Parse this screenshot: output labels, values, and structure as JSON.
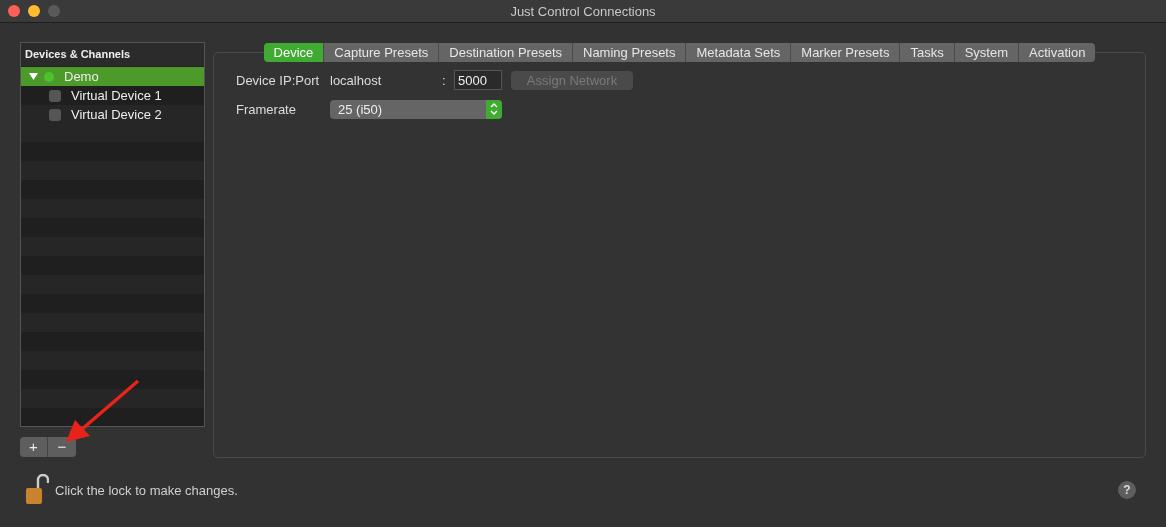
{
  "window": {
    "title": "Just Control Connections"
  },
  "sidebar": {
    "header": "Devices & Channels",
    "tree": [
      {
        "label": "Demo",
        "selected": true,
        "expanded": true,
        "color": "#4cc22c",
        "children": [
          {
            "label": "Virtual Device 1",
            "selected": false,
            "checked": false
          },
          {
            "label": "Virtual Device 2",
            "selected": false,
            "checked": false
          }
        ]
      }
    ],
    "buttons": [
      {
        "label": "+"
      },
      {
        "label": "−"
      }
    ]
  },
  "tabs": [
    {
      "label": "Device",
      "selected": true
    },
    {
      "label": "Capture Presets",
      "selected": false
    },
    {
      "label": "Destination Presets",
      "selected": false
    },
    {
      "label": "Naming Presets",
      "selected": false
    },
    {
      "label": "Metadata Sets",
      "selected": false
    },
    {
      "label": "Marker Presets",
      "selected": false
    },
    {
      "label": "Tasks",
      "selected": false
    },
    {
      "label": "System",
      "selected": false
    },
    {
      "label": "Activation",
      "selected": false
    }
  ],
  "device": {
    "ip_label": "Device IP:Port",
    "ip_value": "localhost",
    "separator": ":",
    "port": "5000",
    "assign_button": {
      "label": "Assign Network",
      "disabled": true
    },
    "framerate_label": "Framerate",
    "framerate": "25 (i50)"
  },
  "footer": {
    "lock_text": "Click the lock to make changes.",
    "help": "?"
  }
}
